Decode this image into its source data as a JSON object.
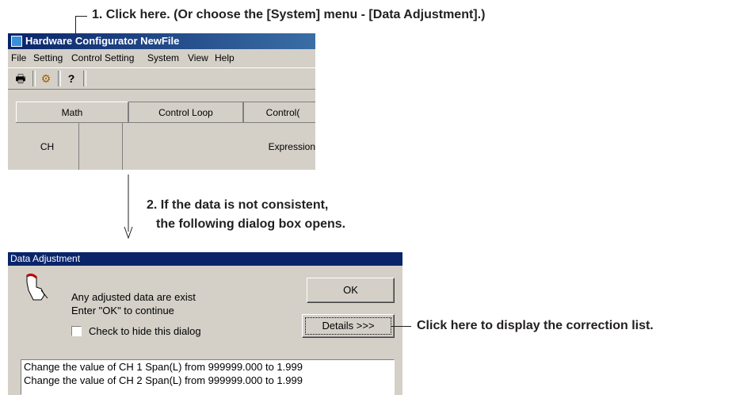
{
  "annotations": {
    "step1": "1. Click here. (Or choose the [System] menu - [Data Adjustment].)",
    "step2_line1": "2. If the data is not consistent,",
    "step2_line2": "the following dialog box opens.",
    "details_note": "Click here to display the correction list."
  },
  "main_window": {
    "title": "Hardware Configurator NewFile",
    "menu": [
      "File",
      "Setting",
      "Control Setting",
      "System",
      "View",
      "Help"
    ],
    "toolbar": [
      {
        "icon": "printer-icon",
        "glyph": "🖶"
      },
      {
        "icon": "data-adjustment-icon",
        "glyph": "⚙"
      },
      {
        "icon": "help-icon",
        "glyph": "?"
      }
    ],
    "tabs": [
      "Math",
      "Control Loop",
      "Control("
    ],
    "grid_headers": [
      "CH",
      "",
      "Expression"
    ]
  },
  "dialog": {
    "title": "Data Adjustment",
    "message_line1": "Any adjusted data are exist",
    "message_line2": "Enter \"OK\" to continue",
    "checkbox_label": "Check to hide this dialog",
    "ok_label": "OK",
    "details_label": "Details >>>",
    "corrections": [
      "Change the value of CH 1 Span(L) from 999999.000 to 1.999",
      "Change the value of CH 2 Span(L) from 999999.000 to 1.999"
    ]
  }
}
